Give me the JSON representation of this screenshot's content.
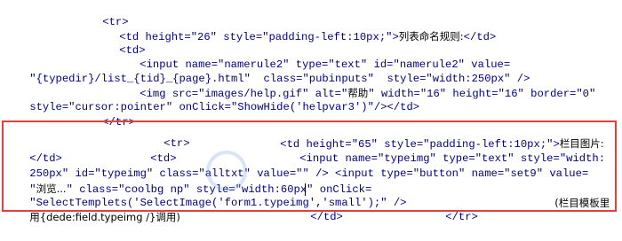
{
  "code_lines": {
    "l01": "<tr>",
    "l02a": "<td height=\"26\" style=\"padding-left:10px;\">",
    "l02b": "列表命名规则:",
    "l02c": "</td>",
    "l03": "<td>",
    "l04": "<input name=\"namerule2\" type=\"text\" id=\"namerule2\" value=",
    "l05": "\"{typedir}/list_{tid}_{page}.html\"  class=\"pubinputs\"  style=\"width:250px\" />",
    "l06a": "<img src=\"images/help.gif\" alt=\"",
    "l06b": "帮助",
    "l06c": "\" width=\"16\" height=\"16\" border=\"0\"",
    "l07": "style=\"cursor:pointer\" onClick=\"ShowHide('helpvar3')\"/></td>",
    "l08": "</tr>",
    "l09a": "<tr>",
    "l09b": "<td height=\"65\" style=\"padding-left:10px;\">",
    "l09c": "栏目图片:",
    "l10a": "</td>",
    "l10b": "<td>",
    "l10c": "<input name=\"typeimg\" type=\"text\" style=\"width:",
    "l11": "250px\" id=\"typeimg\" class=\"alltxt\" value=\"\" /> <input type=\"button\" name=\"set9\" value=",
    "l12a": "\"",
    "l12b": "浏览...",
    "l12c": "\" class=\"coolbg np\" style=\"width:60px\" onClick=",
    "l13a": "\"SelectTemplets('SelectImage('form1.typeimg','small');\" />",
    "l13b": "(栏目模板里",
    "l14a": "用{dede:field.typeimg /}调用)",
    "l14b": "</td>",
    "l14c": "</tr>"
  },
  "highlight_color": "#e2403a",
  "watermark_icon": "watermark-logo-icon"
}
